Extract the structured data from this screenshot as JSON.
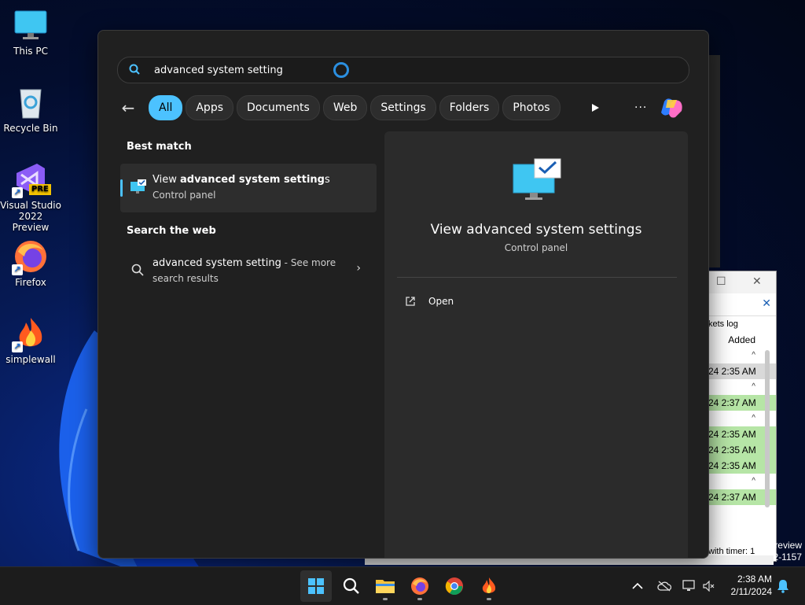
{
  "desktop": {
    "icons": [
      {
        "label": "This PC"
      },
      {
        "label": "Recycle Bin"
      },
      {
        "label": "Visual Studio 2022 Preview",
        "badge": "PRE"
      },
      {
        "label": "Firefox"
      },
      {
        "label": "simplewall"
      }
    ]
  },
  "background_window": {
    "tab_text": "kets log",
    "column_header": "Added",
    "rows": [
      "24 2:35 AM",
      "24 2:37 AM",
      "24 2:35 AM",
      "24 2:35 AM",
      "24 2:35 AM",
      "24 2:37 AM"
    ],
    "status_text": "with timer: 1",
    "preview_lines": [
      "review",
      "2-1157"
    ]
  },
  "search": {
    "query": "advanced system setting",
    "filters": [
      {
        "label": "All",
        "active": true
      },
      {
        "label": "Apps"
      },
      {
        "label": "Documents"
      },
      {
        "label": "Web"
      },
      {
        "label": "Settings"
      },
      {
        "label": "Folders"
      },
      {
        "label": "Photos"
      }
    ],
    "more_label": "···",
    "best_match_label": "Best match",
    "best_match": {
      "title_pre": "View ",
      "title_bold": "advanced system setting",
      "title_post": "s",
      "subtitle": "Control panel"
    },
    "web_label": "Search the web",
    "web_result": {
      "query": "advanced system setting",
      "see_more": " - See more",
      "line2": "search results"
    },
    "preview": {
      "title": "View advanced system settings",
      "subtitle": "Control panel",
      "action_open": "Open"
    }
  },
  "taskbar": {
    "clock_time": "2:38 AM",
    "clock_date": "2/11/2024"
  },
  "colors": {
    "accent": "#4cc2ff",
    "panel_bg": "#202020",
    "preview_bg": "#2b2b2b"
  }
}
